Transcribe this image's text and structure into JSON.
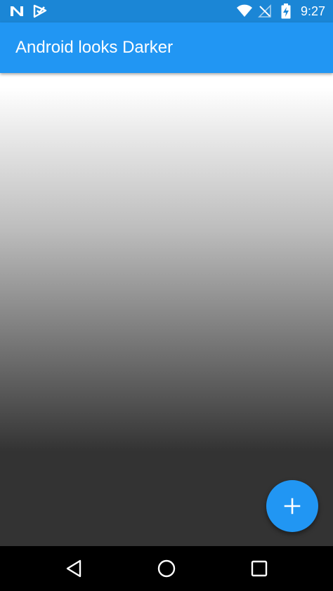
{
  "status_bar": {
    "time": "9:27",
    "left_icons": [
      "notification-n-icon",
      "notification-check-icon"
    ],
    "right_icons": [
      "wifi-icon",
      "no-signal-icon",
      "battery-charging-icon"
    ],
    "color": "#1b86d6"
  },
  "app_bar": {
    "title": "Android looks Darker",
    "color": "#2196f3"
  },
  "content": {
    "gradient_colors": [
      "#ffffff",
      "#bdbdbd",
      "#424242",
      "#333333"
    ]
  },
  "fab": {
    "icon": "plus-icon",
    "color": "#2196f3"
  },
  "nav_bar": {
    "buttons": [
      "back-icon",
      "home-icon",
      "recents-icon"
    ]
  }
}
